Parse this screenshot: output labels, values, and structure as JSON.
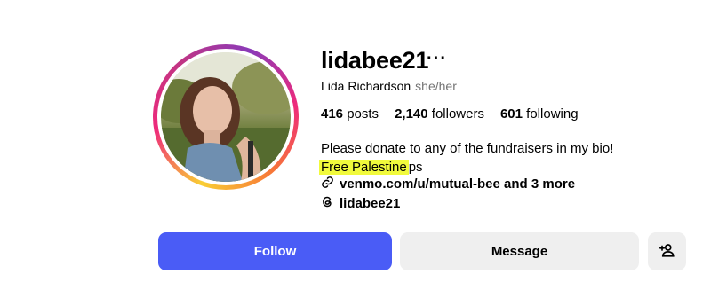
{
  "profile": {
    "username": "lidabee21",
    "more_icon": "ellipsis-icon",
    "full_name": "Lida Richardson",
    "pronouns": "she/her",
    "stats": {
      "posts_count": "416",
      "posts_label": "posts",
      "followers_count": "2,140",
      "followers_label": "followers",
      "following_count": "601",
      "following_label": "following"
    },
    "bio_line1": "Please donate to any of the fundraisers in my bio!",
    "bio_highlight": "Free Palestine",
    "bio_tail": "ps",
    "link_text": "venmo.com/u/mutual-bee and 3 more",
    "threads_handle": "lidabee21"
  },
  "actions": {
    "follow_label": "Follow",
    "message_label": "Message",
    "add_user_icon": "add-person-icon"
  },
  "colors": {
    "follow_bg": "#4a5cf6",
    "secondary_bg": "#efefef",
    "highlight": "#f1fa3c"
  }
}
